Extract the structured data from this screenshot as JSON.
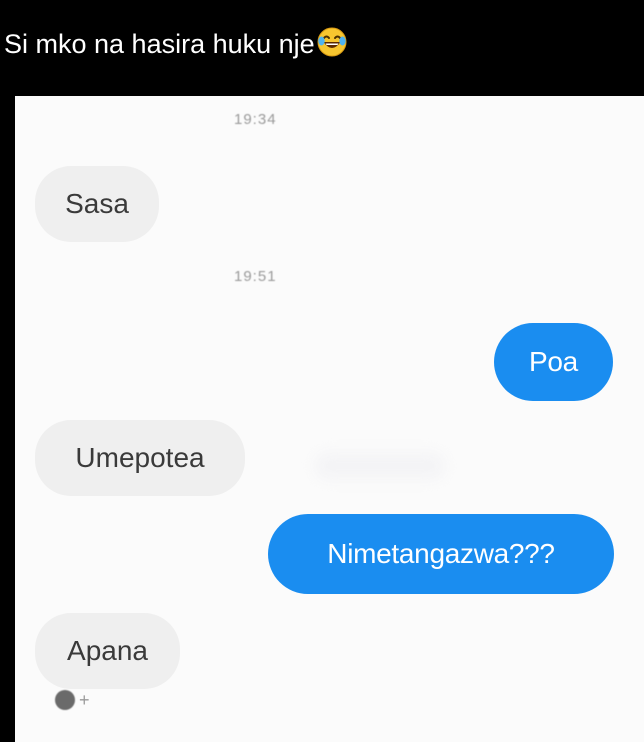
{
  "post": {
    "caption": "Si mko na hasira huku nje",
    "caption_emoji": "laughing-tears-emoji"
  },
  "chat": {
    "messages": [
      {
        "kind": "timestamp",
        "text": "19:34"
      },
      {
        "kind": "incoming",
        "text": "Sasa"
      },
      {
        "kind": "timestamp",
        "text": "19:51"
      },
      {
        "kind": "outgoing",
        "text": "Poa"
      },
      {
        "kind": "incoming",
        "text": "Umepotea"
      },
      {
        "kind": "outgoing",
        "text": "Nimetangazwa???"
      },
      {
        "kind": "incoming",
        "text": "Apana"
      }
    ],
    "reaction_add_icon": "add-reaction-icon"
  },
  "colors": {
    "outgoing_bubble": "#1a8df0",
    "incoming_bubble": "#efefef",
    "chat_background": "#fbfbfb",
    "caption_background": "#000000"
  }
}
